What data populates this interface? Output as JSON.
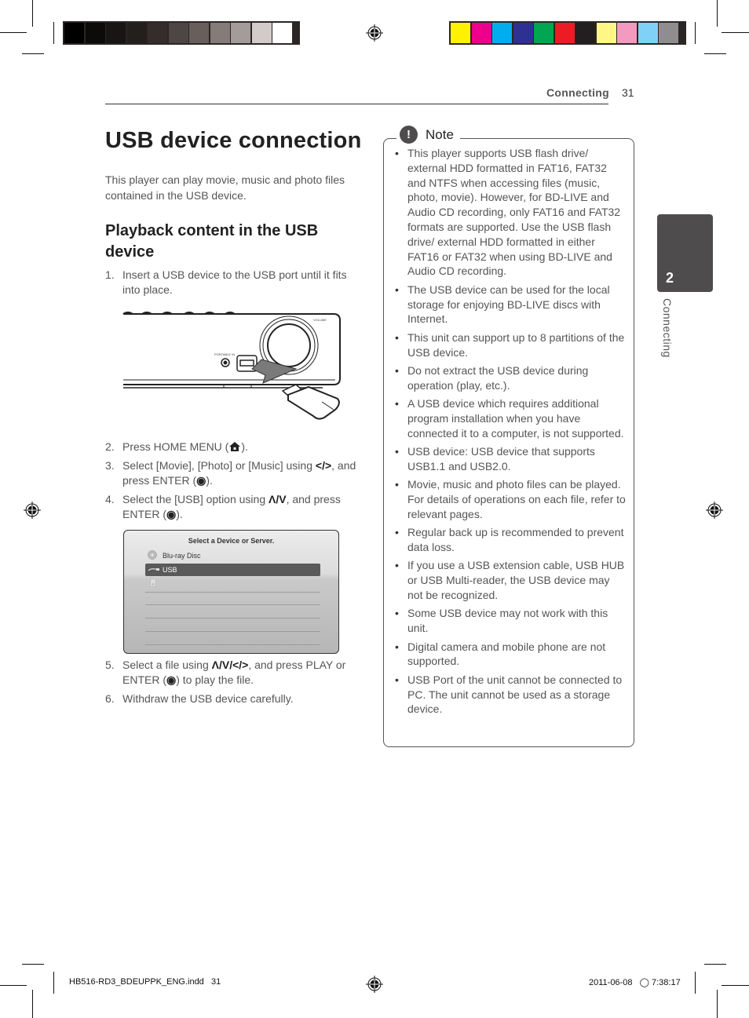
{
  "print_marks": {
    "grayscale_bar": [
      "#000000",
      "#0d0b0a",
      "#181514",
      "#231f1d",
      "#352d2b",
      "#4e4644",
      "#685e5c",
      "#857b79",
      "#a49c9a",
      "#d3cbca",
      "#ffffff"
    ],
    "color_bar": [
      "#fff200",
      "#ec008c",
      "#00aeef",
      "#2e3192",
      "#00a651",
      "#ed1c24",
      "#231f20",
      "#fff685",
      "#f49ac1",
      "#7fd1f7",
      "#8f8d8e"
    ]
  },
  "header": {
    "section": "Connecting",
    "page_number": "31"
  },
  "side_tab": {
    "number": "2",
    "label": "Connecting"
  },
  "main": {
    "title": "USB device connection",
    "intro": "This player can play movie, music and photo files contained in the USB device.",
    "subtitle": "Playback content in the USB device",
    "steps": [
      {
        "num": "1.",
        "text": "Insert a USB device to the USB port until it fits into place."
      },
      {
        "num": "2.",
        "text_a": "Press HOME MENU (",
        "text_b": ")."
      },
      {
        "num": "3.",
        "text_a": "Select [Movie], [Photo] or [Music] using ",
        "sym": "</>",
        "text_b": ", and press ENTER (",
        "text_c": ")."
      },
      {
        "num": "4.",
        "text_a": "Select the [USB] option using ",
        "sym": "Λ/V",
        "text_b": ", and press ENTER (",
        "text_c": ")."
      },
      {
        "num": "5.",
        "text_a": "Select a file using ",
        "sym": "Λ/V/</>",
        "text_b": ", and press PLAY or ENTER (",
        "text_c": ") to play the file."
      },
      {
        "num": "6.",
        "text": "Withdraw the USB device carefully."
      }
    ],
    "device_labels": {
      "portable_in": "PORTABLE IN",
      "volume": "VOLUME"
    },
    "screen": {
      "title": "Select a Device or Server.",
      "items": [
        "Blu-ray Disc",
        "USB",
        "iPod"
      ],
      "selected": "USB"
    }
  },
  "note": {
    "title": "Note",
    "items": [
      "This player supports USB flash drive/ external HDD formatted in FAT16, FAT32 and NTFS when accessing files (music, photo, movie). However, for BD-LIVE and Audio CD recording, only FAT16 and FAT32 formats are supported. Use the USB flash drive/ external HDD formatted in either FAT16 or FAT32 when using BD-LIVE and Audio CD recording.",
      "The USB device can be used for the local storage for enjoying BD-LIVE discs with Internet.",
      "This unit can support up to 8 partitions of the USB device.",
      "Do not extract the USB device during operation (play, etc.).",
      "A USB device which requires additional program installation when you have connected it to a computer, is not supported.",
      "USB device: USB device that supports USB1.1 and USB2.0.",
      "Movie, music and photo files can be played. For details of operations on each file, refer to relevant pages.",
      "Regular back up is recommended to prevent data loss.",
      "If you use a USB extension cable, USB HUB or USB Multi-reader, the USB device may not be recognized.",
      "Some USB device may not work with this unit.",
      "Digital camera and mobile phone are not supported.",
      "USB Port of the unit cannot be connected to PC. The unit cannot be used as a storage device."
    ]
  },
  "footer": {
    "file": "HB516-RD3_BDEUPPK_ENG.indd   31",
    "timestamp": "2011-06-08   ◯ 7:38:17"
  }
}
